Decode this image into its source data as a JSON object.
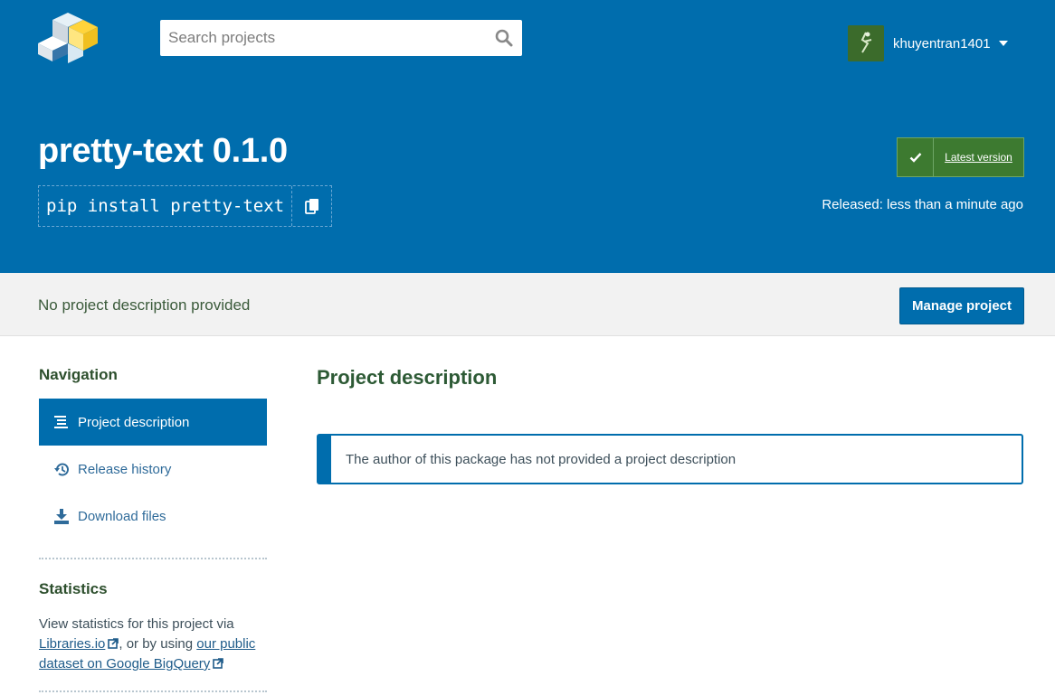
{
  "header": {
    "search_placeholder": "Search projects",
    "username": "khuyentran1401",
    "package_title": "pretty-text 0.1.0",
    "pip_command": "pip install pretty-text",
    "latest_label": "Latest version",
    "released_text": "Released: less than a minute ago"
  },
  "description_bar": {
    "summary": "No project description provided",
    "manage_label": "Manage project"
  },
  "sidebar": {
    "navigation_heading": "Navigation",
    "items": [
      {
        "label": "Project description",
        "icon": "align-left-icon",
        "active": true
      },
      {
        "label": "Release history",
        "icon": "history-icon",
        "active": false
      },
      {
        "label": "Download files",
        "icon": "download-icon",
        "active": false
      }
    ],
    "statistics_heading": "Statistics",
    "statistics_prefix": "View statistics for this project via",
    "libraries_link": "Libraries.io",
    "statistics_middle": ", or by using",
    "bigquery_link": "our public dataset on Google BigQuery"
  },
  "main": {
    "heading": "Project description",
    "notice": "The author of this package has not provided a project description"
  },
  "colors": {
    "brand_blue": "#006dad",
    "latest_green": "#3d7a30",
    "heading_green": "#2d5a35"
  }
}
